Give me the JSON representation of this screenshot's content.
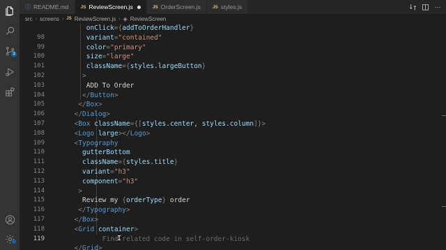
{
  "tabs": [
    {
      "name": "README.md",
      "type": "info",
      "active": false,
      "modified": false
    },
    {
      "name": "ReviewScreen.js",
      "type": "js",
      "active": true,
      "modified": true
    },
    {
      "name": "OrderScreen.js",
      "type": "js",
      "active": false,
      "modified": false
    },
    {
      "name": "styles.js",
      "type": "js",
      "active": false,
      "modified": false
    }
  ],
  "breadcrumb": [
    "src",
    "screens",
    "ReviewScreen.js",
    "ReviewScreen"
  ],
  "activity_icons": [
    "files-icon",
    "search-icon",
    "source-control-icon",
    "run-debug-icon",
    "extensions-icon",
    "account-icon",
    "settings-gear-icon"
  ],
  "source_control_badge": "3",
  "current_line": "119",
  "lines": [
    {
      "n": "",
      "indent": 16,
      "tokens": [
        [
          "attr",
          "onClick"
        ],
        [
          "br",
          "="
        ],
        [
          "br",
          "{"
        ],
        [
          "var",
          "addToOrderHandler"
        ],
        [
          "br",
          "}"
        ]
      ]
    },
    {
      "n": "98",
      "indent": 16,
      "tokens": [
        [
          "attr",
          "variant"
        ],
        [
          "br",
          "="
        ],
        [
          "str",
          "\"contained\""
        ]
      ]
    },
    {
      "n": "99",
      "indent": 16,
      "tokens": [
        [
          "attr",
          "color"
        ],
        [
          "br",
          "="
        ],
        [
          "str",
          "\"primary\""
        ]
      ]
    },
    {
      "n": "100",
      "indent": 16,
      "tokens": [
        [
          "attr",
          "size"
        ],
        [
          "br",
          "="
        ],
        [
          "str",
          "\"large\""
        ]
      ]
    },
    {
      "n": "101",
      "indent": 16,
      "tokens": [
        [
          "attr",
          "className"
        ],
        [
          "br",
          "="
        ],
        [
          "br",
          "{"
        ],
        [
          "var",
          "styles.largeButton"
        ],
        [
          "br",
          "}"
        ]
      ]
    },
    {
      "n": "102",
      "indent": 14,
      "tokens": [
        [
          "br",
          ">"
        ]
      ]
    },
    {
      "n": "103",
      "indent": 16,
      "tokens": [
        [
          "txt",
          "ADD To Order"
        ]
      ]
    },
    {
      "n": "104",
      "indent": 14,
      "tokens": [
        [
          "br",
          "</"
        ],
        [
          "tag",
          "Button"
        ],
        [
          "br",
          ">"
        ]
      ]
    },
    {
      "n": "105",
      "indent": 12,
      "tokens": [
        [
          "br",
          "</"
        ],
        [
          "tag",
          "Box"
        ],
        [
          "br",
          ">"
        ]
      ]
    },
    {
      "n": "106",
      "indent": 10,
      "tokens": [
        [
          "br",
          "</"
        ],
        [
          "tag",
          "Dialog"
        ],
        [
          "br",
          ">"
        ]
      ]
    },
    {
      "n": "107",
      "indent": 10,
      "tokens": [
        [
          "br",
          "<"
        ],
        [
          "tag",
          "Box"
        ],
        [
          "txt",
          " "
        ],
        [
          "attr",
          "className"
        ],
        [
          "br",
          "="
        ],
        [
          "br",
          "{["
        ],
        [
          "var",
          "styles.center"
        ],
        [
          "txt",
          ", "
        ],
        [
          "var",
          "styles.column"
        ],
        [
          "br",
          "]}"
        ],
        [
          "br",
          ">"
        ]
      ]
    },
    {
      "n": "108",
      "indent": 10,
      "tokens": [
        [
          "br",
          "<"
        ],
        [
          "tag",
          "Logo"
        ],
        [
          "txt",
          " "
        ],
        [
          "attr",
          "large"
        ],
        [
          "br",
          "></"
        ],
        [
          "tag",
          "Logo"
        ],
        [
          "br",
          ">"
        ]
      ]
    },
    {
      "n": "109",
      "indent": 10,
      "tokens": [
        [
          "br",
          "<"
        ],
        [
          "tag",
          "Typography"
        ]
      ]
    },
    {
      "n": "110",
      "indent": 14,
      "tokens": [
        [
          "attr",
          "gutterBottom"
        ]
      ]
    },
    {
      "n": "111",
      "indent": 14,
      "tokens": [
        [
          "attr",
          "className"
        ],
        [
          "br",
          "="
        ],
        [
          "br",
          "{"
        ],
        [
          "var",
          "styles.title"
        ],
        [
          "br",
          "}"
        ]
      ]
    },
    {
      "n": "112",
      "indent": 14,
      "tokens": [
        [
          "attr",
          "variant"
        ],
        [
          "br",
          "="
        ],
        [
          "str",
          "\"h3\""
        ]
      ]
    },
    {
      "n": "113",
      "indent": 14,
      "tokens": [
        [
          "attr",
          "component"
        ],
        [
          "br",
          "="
        ],
        [
          "str",
          "\"h3\""
        ]
      ]
    },
    {
      "n": "114",
      "indent": 12,
      "tokens": [
        [
          "br",
          ">"
        ]
      ]
    },
    {
      "n": "115",
      "indent": 14,
      "tokens": [
        [
          "txt",
          "Review my "
        ],
        [
          "br",
          "{"
        ],
        [
          "var",
          "orderType"
        ],
        [
          "br",
          "}"
        ],
        [
          "txt",
          " order"
        ]
      ]
    },
    {
      "n": "116",
      "indent": 12,
      "tokens": [
        [
          "br",
          "</"
        ],
        [
          "tag",
          "Typography"
        ],
        [
          "br",
          ">"
        ]
      ]
    },
    {
      "n": "117",
      "indent": 10,
      "tokens": [
        [
          "br",
          "</"
        ],
        [
          "tag",
          "Box"
        ],
        [
          "br",
          ">"
        ]
      ]
    },
    {
      "n": "118",
      "indent": 10,
      "tokens": [
        [
          "br",
          "<"
        ],
        [
          "tag",
          "Grid"
        ],
        [
          "txt",
          " "
        ],
        [
          "attr",
          "container"
        ],
        [
          "br",
          ">"
        ]
      ]
    },
    {
      "n": "119",
      "indent": 24,
      "tokens": [
        [
          "ghost",
          "Find related code in self-order-kiosk"
        ]
      ]
    },
    {
      "n": "",
      "indent": 10,
      "tokens": [
        [
          "br",
          "</"
        ],
        [
          "tag",
          "Grid"
        ],
        [
          "br",
          ">"
        ]
      ]
    }
  ]
}
